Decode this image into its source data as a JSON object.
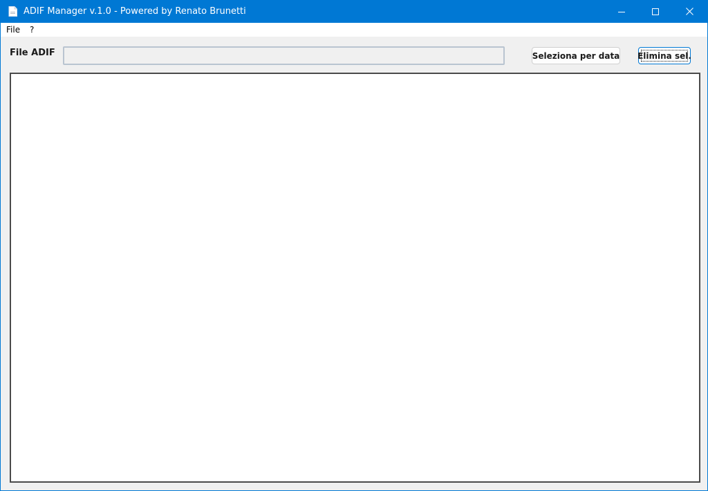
{
  "window": {
    "title": "ADIF Manager v.1.0 - Powered by Renato Brunetti",
    "accent_color": "#0078d4",
    "controls": [
      "minimize-icon",
      "maximize-icon",
      "close-icon"
    ]
  },
  "menu": {
    "file_label": "File",
    "help_label": "?"
  },
  "toolbar": {
    "file_label": "File ADIF",
    "file_path_value": "",
    "select_by_date_label": "Seleziona per data",
    "delete_selected_label": "Elimina sel."
  },
  "list": {
    "items": []
  }
}
